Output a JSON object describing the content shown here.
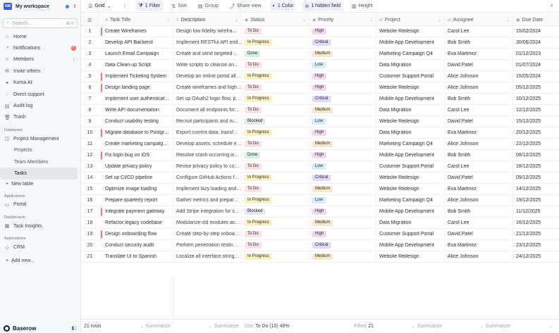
{
  "workspace": {
    "logo": "NM",
    "name": "My workspace"
  },
  "search": {
    "placeholder": "Search...",
    "shortcut": "⌘ K"
  },
  "nav": [
    {
      "icon": "home-icon",
      "glyph": "⌂",
      "label": "Home"
    },
    {
      "icon": "bell-icon",
      "glyph": "◔",
      "label": "Notifications",
      "badge": "6"
    },
    {
      "icon": "users-icon",
      "glyph": "☺",
      "label": "Members"
    },
    {
      "icon": "invite-icon",
      "glyph": "✉",
      "label": "Invite others"
    },
    {
      "icon": "sparkle-icon",
      "glyph": "✦",
      "label": "Kuma AI"
    },
    {
      "icon": "support-icon",
      "glyph": "◌",
      "label": "Direct support"
    },
    {
      "icon": "log-icon",
      "glyph": "▤",
      "label": "Audit log"
    },
    {
      "icon": "trash-icon",
      "glyph": "🗑",
      "label": "Trash"
    }
  ],
  "sections": {
    "databases": "Databases",
    "applications": "Applications",
    "dashboards": "Dashboards",
    "automations": "Automations"
  },
  "database": {
    "name": "Project Management",
    "tables": [
      "Projects",
      "Team Members",
      "Tasks"
    ],
    "new_table": "New table"
  },
  "apps": {
    "portal": "Portal"
  },
  "dashboards": {
    "task_insights": "Task Insights"
  },
  "automations": {
    "crm": "CRM"
  },
  "add_new": "Add new...",
  "brand": "Baserow",
  "toolbar": {
    "view": "Grid",
    "filter": "1 Filter",
    "sort": "Sort",
    "group": "Group",
    "share": "Share view",
    "color": "1 Color",
    "hidden": "1 hidden field",
    "height": "Height"
  },
  "columns": {
    "title": "Task Title",
    "description": "Description",
    "status": "Status",
    "priority": "Priority",
    "project": "Project",
    "assignee": "Assignee",
    "due": "Due Date"
  },
  "rows": [
    {
      "n": "1",
      "title": "Create Wireframes",
      "desc": "Design low-fidelity wirefra…",
      "status": "To Do",
      "priority": "High",
      "project": "Website Redesign",
      "assignee": "Carol Lee",
      "due": "15/02/2024",
      "flag": true
    },
    {
      "n": "2",
      "title": "Develop API Backend",
      "desc": "Implement RESTful API end…",
      "status": "In Progress",
      "priority": "Critical",
      "project": "Mobile App Development",
      "assignee": "Bob Smith",
      "due": "30/06/2024",
      "flag": false
    },
    {
      "n": "3",
      "title": "Launch Email Campaign",
      "desc": "Create and send targeted …",
      "status": "Done",
      "priority": "Medium",
      "project": "Marketing Campaign Q4",
      "assignee": "Eva Martinez",
      "due": "01/12/2023",
      "flag": false
    },
    {
      "n": "4",
      "title": "Data Clean-up Script",
      "desc": "Write scripts to cleanse an…",
      "status": "To Do",
      "priority": "Low",
      "project": "Data Migration",
      "assignee": "David Patel",
      "due": "01/07/2024",
      "flag": false
    },
    {
      "n": "5",
      "title": "Implement Ticketing System",
      "desc": "Develop an online portal all…",
      "status": "In Progress",
      "priority": "High",
      "project": "Customer Support Portal",
      "assignee": "Alice Johnson",
      "due": "15/05/2024",
      "flag": true
    },
    {
      "n": "6",
      "title": "Design landing page",
      "desc": "Create wireframes and high…",
      "status": "To Do",
      "priority": "High",
      "project": "Website Redesign",
      "assignee": "Alice Johnson",
      "due": "05/12/2025",
      "flag": true
    },
    {
      "n": "7",
      "title": "Implement user authenticat…",
      "desc": "Set up OAuth2 login flow, p…",
      "status": "In Progress",
      "priority": "Critical",
      "project": "Mobile App Development",
      "assignee": "Bob Smith",
      "due": "10/12/2025",
      "flag": false
    },
    {
      "n": "8",
      "title": "Write API documentation",
      "desc": "Document all endpoints for…",
      "status": "To Do",
      "priority": "Medium",
      "project": "Data Migration",
      "assignee": "Carol Lee",
      "due": "12/12/2025",
      "flag": false
    },
    {
      "n": "9",
      "title": "Conduct usability testing",
      "desc": "Recruit participants and ru…",
      "status": "Blocked",
      "priority": "Low",
      "project": "Website Redesign",
      "assignee": "David Patel",
      "due": "15/12/2025",
      "flag": false
    },
    {
      "n": "10",
      "title": "Migrate database to Postgr…",
      "desc": "Export current data, transf…",
      "status": "In Progress",
      "priority": "High",
      "project": "Data Migration",
      "assignee": "Eva Martinez",
      "due": "20/12/2025",
      "flag": true
    },
    {
      "n": "11",
      "title": "Create marketing campaig…",
      "desc": "Develop assets, schedule e…",
      "status": "To Do",
      "priority": "Medium",
      "project": "Marketing Campaign Q4",
      "assignee": "Alice Johnson",
      "due": "22/12/2025",
      "flag": false
    },
    {
      "n": "12",
      "title": "Fix login bug on iOS",
      "desc": "Resolve crash occurring w…",
      "status": "Done",
      "priority": "High",
      "project": "Mobile App Development",
      "assignee": "Bob Smith",
      "due": "08/12/2025",
      "flag": true
    },
    {
      "n": "13",
      "title": "Update privacy policy",
      "desc": "Revise privacy policy to co…",
      "status": "To Do",
      "priority": "Low",
      "project": "Customer Support Portal",
      "assignee": "Carol Lee",
      "due": "18/12/2025",
      "flag": false
    },
    {
      "n": "14",
      "title": "Set up CI/CD pipeline",
      "desc": "Configure GitHub Actions f…",
      "status": "In Progress",
      "priority": "Critical",
      "project": "Website Redesign",
      "assignee": "David Patel",
      "due": "09/12/2025",
      "flag": false
    },
    {
      "n": "15",
      "title": "Optimize image loading",
      "desc": "Implement lazy loading and…",
      "status": "To Do",
      "priority": "Medium",
      "project": "Website Redesign",
      "assignee": "Eva Martinez",
      "due": "14/12/2025",
      "flag": false
    },
    {
      "n": "16",
      "title": "Prepare quarterly report",
      "desc": "Gather metrics and prepar…",
      "status": "In Progress",
      "priority": "Low",
      "project": "Marketing Campaign Q4",
      "assignee": "Alice Johnson",
      "due": "19/12/2025",
      "flag": false
    },
    {
      "n": "17",
      "title": "Integrate payment gateway",
      "desc": "Add Stripe integration for s…",
      "status": "Blocked",
      "priority": "High",
      "project": "Mobile App Development",
      "assignee": "Bob Smith",
      "due": "11/12/2025",
      "flag": true
    },
    {
      "n": "18",
      "title": "Refactor legacy codebase",
      "desc": "Modularize old modules an…",
      "status": "In Progress",
      "priority": "Medium",
      "project": "Data Migration",
      "assignee": "Carol Lee",
      "due": "16/12/2025",
      "flag": false
    },
    {
      "n": "19",
      "title": "Design onboarding flow",
      "desc": "Create step-by-step onboa…",
      "status": "To Do",
      "priority": "High",
      "project": "Customer Support Portal",
      "assignee": "David Patel",
      "due": "21/12/2025",
      "flag": true
    },
    {
      "n": "20",
      "title": "Conduct security audit",
      "desc": "Perform penetration testin…",
      "status": "To Do",
      "priority": "Critical",
      "project": "Mobile App Development",
      "assignee": "Eva Martinez",
      "due": "23/12/2025",
      "flag": false
    },
    {
      "n": "21",
      "title": "Translate UI to Spanish",
      "desc": "Localize all interface string…",
      "status": "In Progress",
      "priority": "Medium",
      "project": "Website Redesign",
      "assignee": "Alice Johnson",
      "due": "24/12/2025",
      "flag": false
    }
  ],
  "footer": {
    "rows": "21 rows",
    "summarize": "Summarize",
    "dist_label": "Dist",
    "dist_value": "To Do (10) 48%",
    "filled_label": "Filled",
    "filled_value": "21"
  },
  "colors": {
    "accent": "#3b5bdb",
    "todo": "#fde2e4",
    "in_progress": "#fdf0c4",
    "done": "#d3f5dc",
    "blocked": "#e5e7eb",
    "high": "#f7d7f0",
    "critical": "#e4d7fb",
    "medium": "#fce8c8",
    "low": "#dbeafe",
    "row_flag": "#f87171"
  }
}
